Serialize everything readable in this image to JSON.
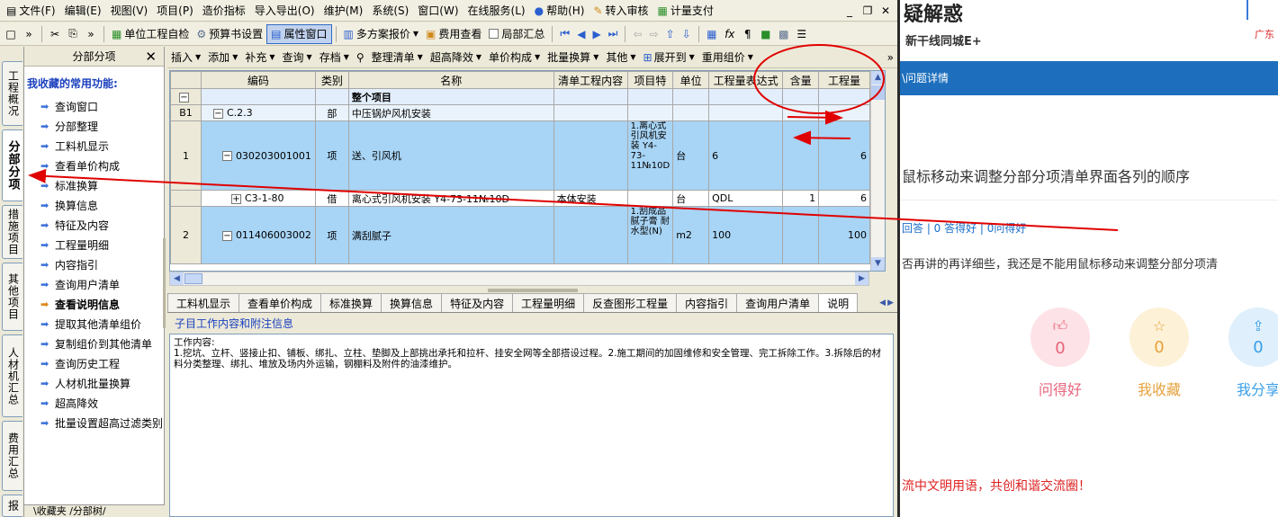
{
  "menubar": {
    "items": [
      {
        "label": "文件(F)",
        "icon": "document-icon"
      },
      {
        "label": "编辑(E)"
      },
      {
        "label": "视图(V)"
      },
      {
        "label": "项目(P)"
      },
      {
        "label": "造价指标"
      },
      {
        "label": "导入导出(O)"
      },
      {
        "label": "维护(M)"
      },
      {
        "label": "系统(S)"
      },
      {
        "label": "窗口(W)"
      },
      {
        "label": "在线服务(L)"
      },
      {
        "label": "帮助(H)",
        "icon": "help-icon"
      },
      {
        "label": "转入审核",
        "icon": "check-icon"
      },
      {
        "label": "计量支付",
        "icon": "pay-icon"
      }
    ]
  },
  "toolbar1": {
    "self_check": "单位工程自检",
    "budget_settings": "预算书设置",
    "property_window": "属性窗口",
    "multi_scheme": "多方案报价",
    "fee_view": "费用查看",
    "local_summary": "局部汇总"
  },
  "vtabs": [
    {
      "label": "工程概况"
    },
    {
      "label": "分部分项"
    },
    {
      "label": "措施项目"
    },
    {
      "label": "其他项目"
    },
    {
      "label": "人材机汇总"
    },
    {
      "label": "费用汇总"
    },
    {
      "label": "报"
    }
  ],
  "favorites": {
    "header": "分部分项",
    "title": "我收藏的常用功能:",
    "items": [
      "查询窗口",
      "分部整理",
      "工料机显示",
      "查看单价构成",
      "标准换算",
      "换算信息",
      "特征及内容",
      "工程量明细",
      "内容指引",
      "查询用户清单",
      "查看说明信息",
      "提取其他清单组价",
      "复制组价到其他清单",
      "查询历史工程",
      "人材机批量换算",
      "超高降效",
      "批量设置超高过滤类别"
    ],
    "footer": "\\收藏夹 /分部树/"
  },
  "toolbar2": {
    "items": [
      "插入",
      "添加",
      "补充",
      "查询",
      "存档",
      "整理清单",
      "超高降效",
      "单价构成",
      "批量换算",
      "其他",
      "展开到",
      "重用组价"
    ]
  },
  "grid": {
    "columns": [
      "编码",
      "类别",
      "名称",
      "清单工程内容",
      "项目特",
      "单位",
      "工程量表达式",
      "含量",
      "工程量"
    ],
    "rows": [
      {
        "rowno": "",
        "code": "",
        "type": "",
        "name": "整个项目",
        "content": "",
        "feature": "",
        "unit": "",
        "expr": "",
        "qty_ratio": "",
        "qty": ""
      },
      {
        "rowno": "B1",
        "code": "C.2.3",
        "type": "部",
        "name": "中压锅炉风机安装",
        "content": "",
        "feature": "",
        "unit": "",
        "expr": "",
        "qty_ratio": "",
        "qty": ""
      },
      {
        "rowno": "1",
        "code": "030203001001",
        "type": "项",
        "name": "送、引风机",
        "content": "",
        "feature": "1.离心式引风机安装 Y4-73-11№10D",
        "unit": "台",
        "expr": "6",
        "qty_ratio": "",
        "qty": "6"
      },
      {
        "rowno": "",
        "code": "C3-1-80",
        "type": "借",
        "name": "离心式引风机安装 Y4-73-11№10D",
        "content": "本体安装",
        "feature": "",
        "unit": "台",
        "expr": "QDL",
        "qty_ratio": "1",
        "qty": "6"
      },
      {
        "rowno": "2",
        "code": "011406003002",
        "type": "项",
        "name": "满刮腻子",
        "content": "",
        "feature": "1.刮成品腻子膏 耐水型(N)",
        "unit": "m2",
        "expr": "100",
        "qty_ratio": "",
        "qty": "100"
      }
    ]
  },
  "bottom_tabs": [
    "工料机显示",
    "查看单价构成",
    "标准换算",
    "换算信息",
    "特征及内容",
    "工程量明细",
    "反查图形工程量",
    "内容指引",
    "查询用户清单",
    "说明"
  ],
  "detail": {
    "subtitle": "子目工作内容和附注信息",
    "heading": "工作内容:",
    "body": "1.挖坑、立杆、竖接止扣、铺板、绑扎、立柱、垫脚及上部挑出承托和拉杆、挂安全网等全部搭设过程。2.施工期间的加固维修和安全管理、完工拆除工作。3.拆除后的材料分类整理、绑扎、堆放及场内外运输，钢棚料及附件的油漆维护。"
  },
  "right_pane": {
    "brand": "疑解惑",
    "sub": "新干线同城E+",
    "region": "广东",
    "breadcrumb": "\\问题详情",
    "question": "鼠标移动来调整分部分项清单界面各列的顺序",
    "stats": "回答 | 0 答得好 | 0问得好",
    "desc": "否再讲的再详细些，我还是不能用鼠标移动来调整分部分项清",
    "actions": [
      {
        "label": "问得好",
        "count": "0",
        "icon": "thumbs-up-icon",
        "color": "#e8637a",
        "bg": "#fde3e7"
      },
      {
        "label": "我收藏",
        "count": "0",
        "icon": "star-icon",
        "color": "#e6a23c",
        "bg": "#fdf1d8"
      },
      {
        "label": "我分享",
        "count": "0",
        "icon": "share-icon",
        "color": "#3a9ee8",
        "bg": "#dff0fc"
      }
    ],
    "footer": "流中文明用语，共创和谐交流圈！"
  },
  "colors": {
    "annotation_red": "#e00000",
    "highlight_header": "#f4b455",
    "selected_row": "#a8d4f5",
    "brand_blue": "#1d6fbd"
  }
}
